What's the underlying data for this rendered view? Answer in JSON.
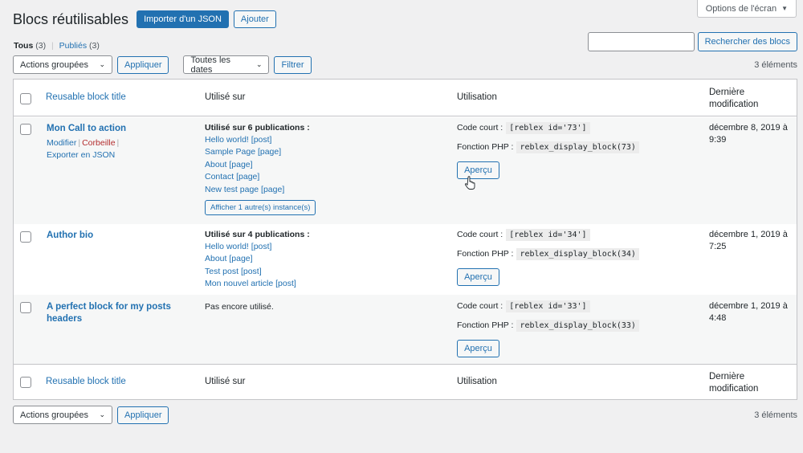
{
  "screen_options": {
    "label": "Options de l'écran"
  },
  "header": {
    "title": "Blocs réutilisables",
    "import_label": "Importer d'un JSON",
    "add_label": "Ajouter"
  },
  "views": {
    "all_label": "Tous",
    "all_count": "(3)",
    "published_label": "Publiés",
    "published_count": "(3)"
  },
  "search": {
    "value": "",
    "button_label": "Rechercher des blocs"
  },
  "tablenav_top": {
    "bulk_label": "Actions groupées",
    "apply_label": "Appliquer",
    "dates_label": "Toutes les dates",
    "filter_label": "Filtrer",
    "count": "3 éléments"
  },
  "tablenav_bottom": {
    "bulk_label": "Actions groupées",
    "apply_label": "Appliquer",
    "count": "3 éléments"
  },
  "columns": {
    "title": "Reusable block title",
    "used_on": "Utilisé sur",
    "usage": "Utilisation",
    "modified": "Dernière modification"
  },
  "rows": [
    {
      "title": "Mon Call to action",
      "actions": {
        "edit": "Modifier",
        "trash": "Corbeille",
        "export": "Exporter en JSON"
      },
      "used_on_heading": "Utilisé sur 6 publications :",
      "used_on": [
        "Hello world! [post]",
        "Sample Page [page]",
        "About [page]",
        "Contact [page]",
        "New test page [page]"
      ],
      "more_label": "Afficher 1 autre(s) instance(s)",
      "shortcode_label": "Code court :",
      "shortcode": "[reblex id='73']",
      "php_label": "Fonction PHP :",
      "php": "reblex_display_block(73)",
      "preview_label": "Aperçu",
      "date": "décembre 8, 2019 à 9:39"
    },
    {
      "title": "Author bio",
      "used_on_heading": "Utilisé sur 4 publications :",
      "used_on": [
        "Hello world! [post]",
        "About [page]",
        "Test post [post]",
        "Mon nouvel article [post]"
      ],
      "shortcode_label": "Code court :",
      "shortcode": "[reblex id='34']",
      "php_label": "Fonction PHP :",
      "php": "reblex_display_block(34)",
      "preview_label": "Aperçu",
      "date": "décembre 1, 2019 à 7:25"
    },
    {
      "title": "A perfect block for my posts headers",
      "used_on_text": "Pas encore utilisé.",
      "shortcode_label": "Code court :",
      "shortcode": "[reblex id='33']",
      "php_label": "Fonction PHP :",
      "php": "reblex_display_block(33)",
      "preview_label": "Aperçu",
      "date": "décembre 1, 2019 à 4:48"
    }
  ],
  "colors": {
    "accent": "#2271b1",
    "trash": "#b32d2e",
    "alt_row": "#f6f7f7",
    "background": "#f0f0f1"
  }
}
